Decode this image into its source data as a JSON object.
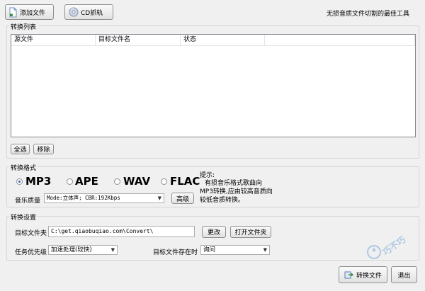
{
  "toolbar": {
    "add_file_label": "添加文件",
    "cd_rip_label": "CD抓轨",
    "tagline": "无损音质文件切割的最佳工具"
  },
  "convert_list": {
    "title": "转换列表",
    "columns": [
      "源文件",
      "目标文件名",
      "状态"
    ],
    "select_all_label": "全选",
    "remove_label": "移除"
  },
  "format": {
    "title": "转换格式",
    "options": [
      "MP3",
      "APE",
      "WAV",
      "FLAC"
    ],
    "selected": "MP3",
    "quality_label": "音乐质量",
    "quality_value": "Mode:立体声; CBR:192Kbps",
    "advanced_label": "高级",
    "hint_title": "提示:",
    "hint_text": "有损音乐格式歌曲向MP3转换,应由较高音质向较低音质转换。"
  },
  "settings": {
    "title": "转换设置",
    "target_folder_label": "目标文件夹",
    "target_folder_value": "C:\\get.qiaobuqiao.com\\Convert\\",
    "change_label": "更改",
    "open_folder_label": "打开文件夹",
    "priority_label": "任务优先级",
    "priority_value": "加速处理(较快)",
    "exists_label": "目标文件存在时",
    "exists_value": "询问"
  },
  "footer": {
    "convert_label": "转换文件",
    "exit_label": "退出"
  },
  "watermark": "巧不巧"
}
